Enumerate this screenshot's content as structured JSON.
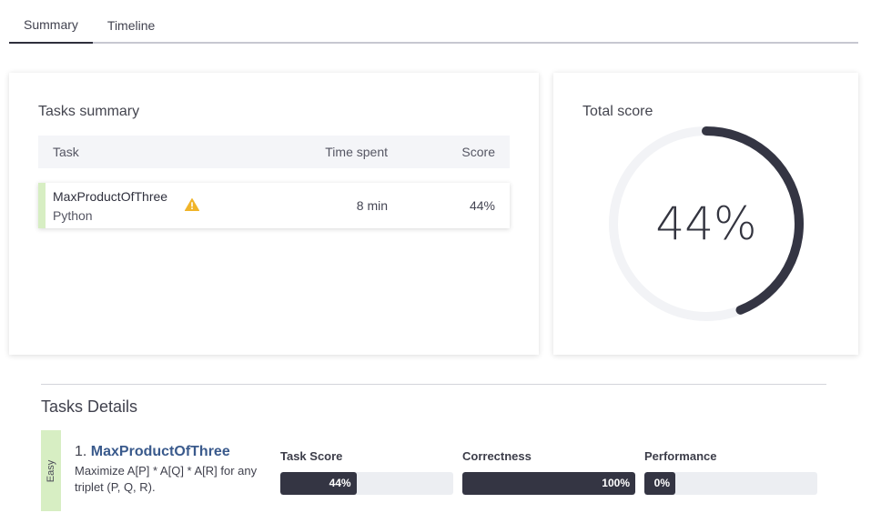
{
  "tabs": [
    {
      "label": "Summary",
      "active": true
    },
    {
      "label": "Timeline",
      "active": false
    }
  ],
  "summary": {
    "title": "Tasks summary",
    "columns": {
      "task": "Task",
      "time": "Time spent",
      "score": "Score"
    },
    "rows": [
      {
        "name": "MaxProductOfThree",
        "language": "Python",
        "time": "8 min",
        "score": "44%",
        "warning": true
      }
    ]
  },
  "total": {
    "title": "Total score",
    "value_text": "44%",
    "value": 0.44,
    "track_color": "#f2f3f6",
    "arc_color": "#343543"
  },
  "details": {
    "title": "Tasks Details",
    "task": {
      "difficulty": "Easy",
      "index": "1.",
      "name": "MaxProductOfThree",
      "description": "Maximize A[P] * A[Q] * A[R] for any triplet (P, Q, R).",
      "metrics": [
        {
          "label": "Task Score",
          "text": "44%",
          "value": 0.44
        },
        {
          "label": "Correctness",
          "text": "100%",
          "value": 1.0
        },
        {
          "label": "Performance",
          "text": "0%",
          "value": 0.0
        }
      ]
    }
  },
  "colors": {
    "easy": "#d7eec3",
    "warning": "#f0b429",
    "link": "#3a5a8c",
    "bar_fill": "#343543",
    "bar_track": "#eceef2"
  }
}
